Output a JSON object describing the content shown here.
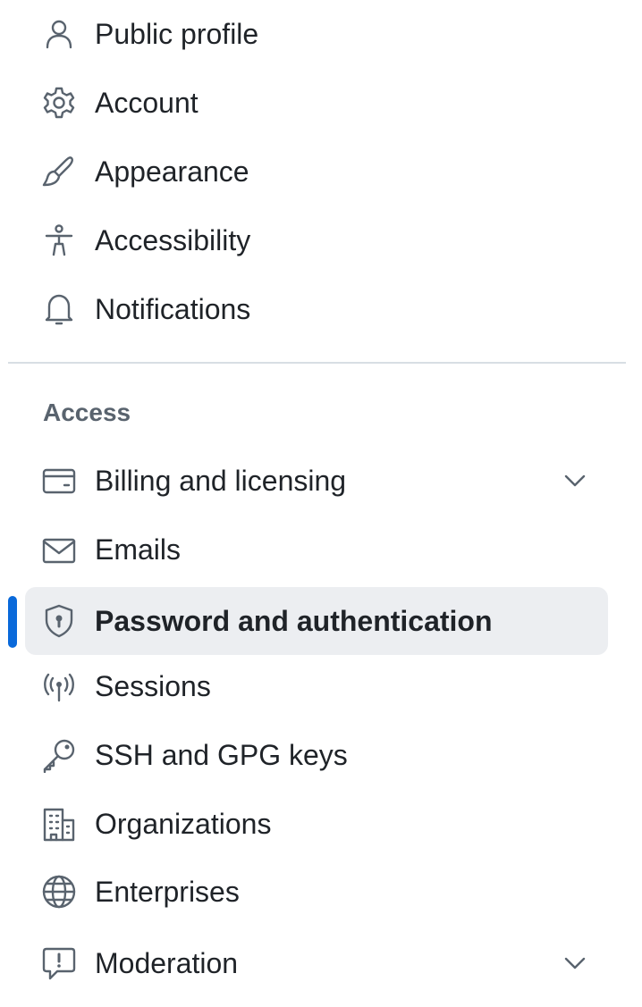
{
  "settings_nav": {
    "personal_items": [
      {
        "label": "Public profile",
        "icon": "person-icon"
      },
      {
        "label": "Account",
        "icon": "gear-icon"
      },
      {
        "label": "Appearance",
        "icon": "paintbrush-icon"
      },
      {
        "label": "Accessibility",
        "icon": "accessibility-icon"
      },
      {
        "label": "Notifications",
        "icon": "bell-icon"
      }
    ],
    "access_heading": "Access",
    "access_items": [
      {
        "label": "Billing and licensing",
        "icon": "credit-card-icon",
        "expandable": true
      },
      {
        "label": "Emails",
        "icon": "mail-icon"
      },
      {
        "label": "Password and authentication",
        "icon": "shield-lock-icon",
        "selected": true
      },
      {
        "label": "Sessions",
        "icon": "broadcast-icon"
      },
      {
        "label": "SSH and GPG keys",
        "icon": "key-icon"
      },
      {
        "label": "Organizations",
        "icon": "organization-icon"
      },
      {
        "label": "Enterprises",
        "icon": "globe-icon"
      },
      {
        "label": "Moderation",
        "icon": "report-icon",
        "expandable": true
      }
    ]
  },
  "colors": {
    "accent": "#0969da",
    "selected_background": "#eceef1",
    "icon": "#59636e",
    "text": "#1f2328",
    "divider": "#d8dee4"
  }
}
